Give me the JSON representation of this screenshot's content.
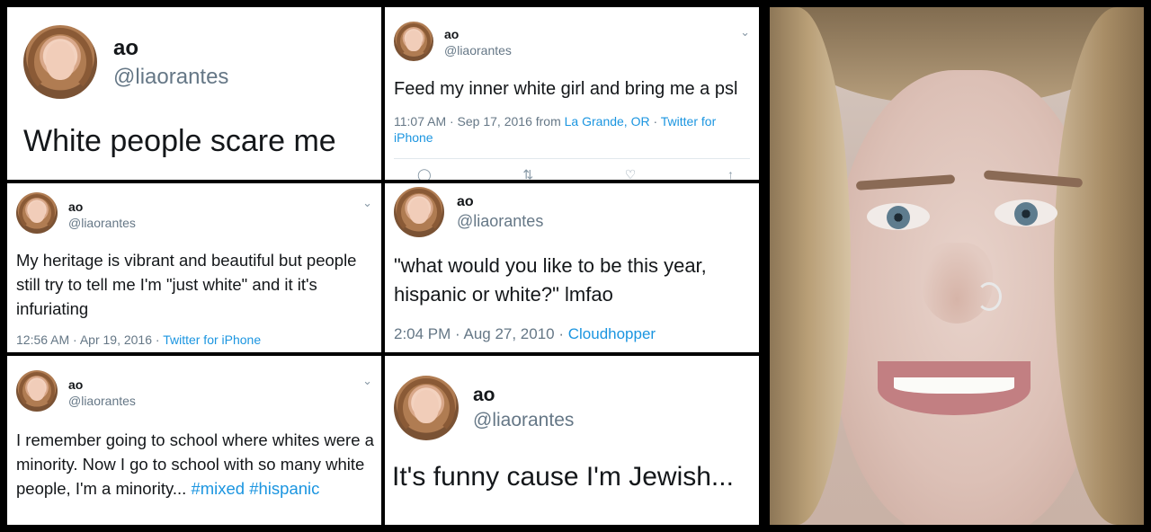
{
  "tweets": [
    {
      "name": "ao",
      "handle": "@liaorantes",
      "text": "White people scare me"
    },
    {
      "name": "ao",
      "handle": "@liaorantes",
      "text": "Feed my inner white girl and bring me a psl",
      "time": "11:07 AM · Sep 17, 2016 from ",
      "location": "La Grande, OR",
      "sep": " · ",
      "source": "Twitter for iPhone"
    },
    {
      "name": "ao",
      "handle": "@liaorantes",
      "text": "My heritage is vibrant and beautiful but people still try to tell me I'm \"just white\" and it it's infuriating",
      "time": "12:56 AM · Apr 19, 2016 · ",
      "source": "Twitter for iPhone"
    },
    {
      "name": "ao",
      "handle": "@liaorantes",
      "text": "\"what would you like to be this year, hispanic or white?\" lmfao",
      "time": "2:04 PM · Aug 27, 2010 · ",
      "source": "Cloudhopper"
    },
    {
      "name": "ao",
      "handle": "@liaorantes",
      "text": "I remember going to school where whites were a minority. Now I go to school with so many white people, I'm a minority... ",
      "hashtag1": "#mixed",
      "hashtag2": "#hispanic"
    },
    {
      "name": "ao",
      "handle": "@liaorantes",
      "text": "It's funny cause I'm Jewish..."
    }
  ],
  "icons": {
    "chevron": "chevron-down-icon",
    "reply": "reply-icon",
    "retweet": "retweet-icon",
    "like": "heart-icon",
    "share": "share-icon"
  },
  "colors": {
    "link": "#1b95e0",
    "meta": "#657786",
    "text": "#14171a"
  }
}
